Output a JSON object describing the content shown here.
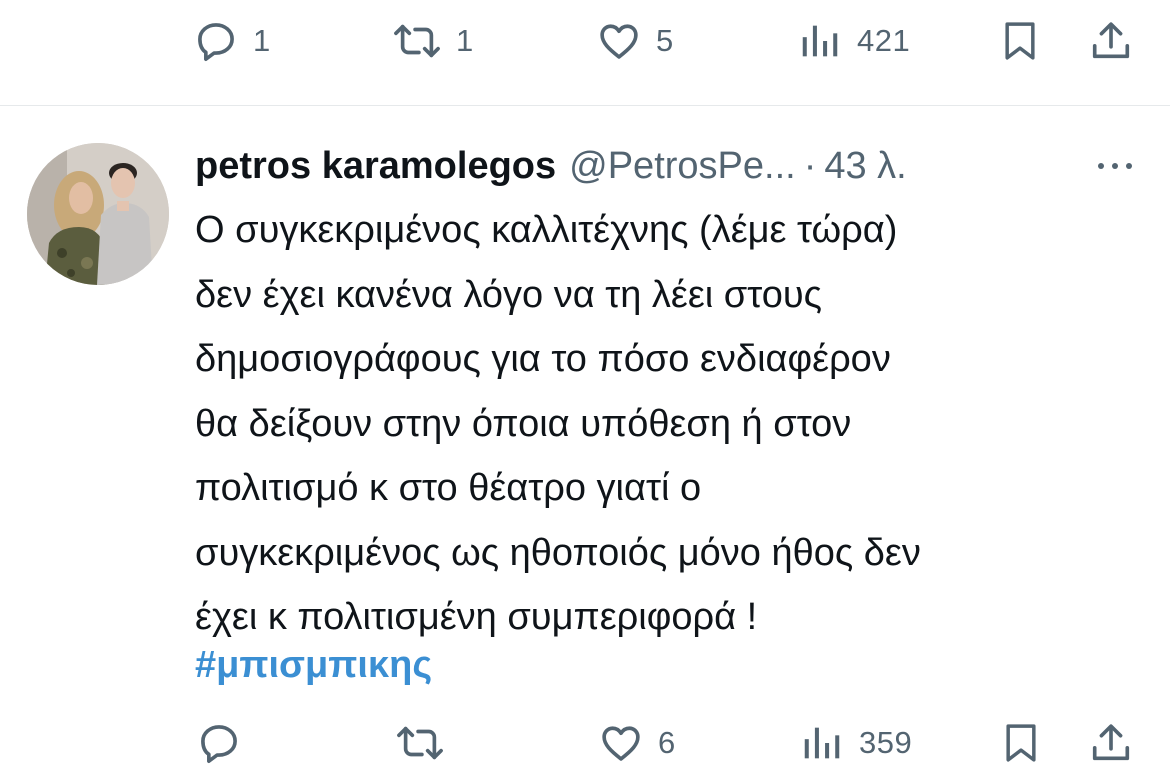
{
  "previous_tweet": {
    "actions": {
      "reply_count": "1",
      "retweet_count": "1",
      "like_count": "5",
      "views_count": "421"
    }
  },
  "tweet": {
    "author_name": "petros karamolegos",
    "author_handle": "@PetrosPe...",
    "separator": "·",
    "timestamp": "43 λ.",
    "text_lines": [
      "Ο συγκεκριμένος καλλιτέχνης (λέμε τώρα)",
      "δεν έχει κανένα λόγο να τη λέει στους",
      "δημοσιογράφους για το πόσο ενδιαφέρον",
      "θα δείξουν στην όποια υπόθεση ή στον",
      "πολιτισμό κ στο θέατρο γιατί ο",
      "συγκεκριμένος ως ηθοποιός μόνο ήθος δεν",
      "έχει κ πολιτισμένη συμπεριφορά !"
    ],
    "hashtag": "#μπισμπικης",
    "actions": {
      "reply_count": "",
      "retweet_count": "",
      "like_count": "6",
      "views_count": "359"
    }
  },
  "colors": {
    "text": "#0f1419",
    "secondary": "#536471",
    "hashtag": "#3b8fd3",
    "divider": "#e6e9eb"
  },
  "icons": [
    "reply-icon",
    "retweet-icon",
    "like-icon",
    "views-icon",
    "bookmark-icon",
    "share-icon",
    "more-icon"
  ]
}
